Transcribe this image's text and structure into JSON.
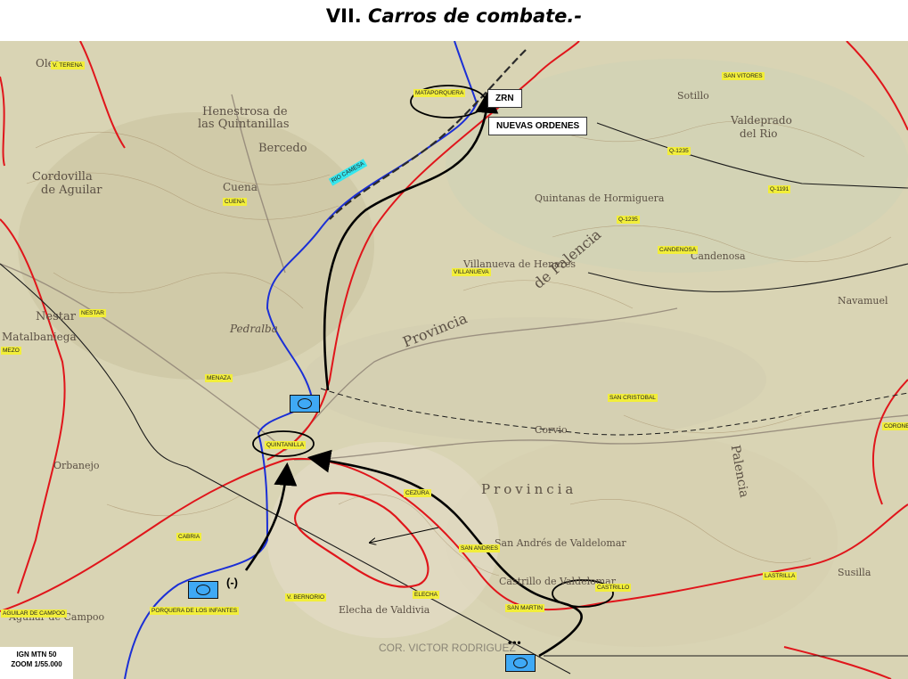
{
  "title": {
    "prefix": "VII.",
    "text": "Carros de combate.-"
  },
  "callouts": {
    "zrn": "ZRN",
    "orders": "NUEVAS ORDENES"
  },
  "scale": {
    "line1": "IGN MTN 50",
    "line2": "ZOOM 1/55.000"
  },
  "unit_minus": "(-)",
  "echelon_dots": "•••",
  "watermark": "COR. VICTOR RODRIGUEZ",
  "labels": {
    "v_terena": "V. TERENA",
    "cuena": "CUENA",
    "nestar": "NESTAR",
    "menaza": "MENAZA",
    "quintanilla": "QUINTANILLA",
    "cabria": "CABRIA",
    "porquera_infantes": "PORQUERA DE LOS INFANTES",
    "v_bernorio": "V. BERNORIO",
    "elecha": "ELECHA",
    "san_martin": "SAN MARTIN",
    "castrillo": "CASTRILLO",
    "lastrilla": "LASTRILLA",
    "san_andres": "SAN ANDRES",
    "cezura": "CEZURA",
    "san_cristobal": "SAN CRISTOBAL",
    "villanueva": "VILLANUEVA",
    "candenosa": "CANDENOSA",
    "mataporquera": "MATAPORQUERA",
    "san_vitores": "SAN VITORES",
    "q1235a": "Q-1235",
    "q1191": "Q-1191",
    "q1235b": "Q-1235",
    "rio_camesa": "RIO CAMESA",
    "coronelo": "CORONELO",
    "aguilar": "AGUILAR DE CAMPOO",
    "mezo": "MEZO"
  },
  "map_text": {
    "henestrosa": "Henestrosa de",
    "quintanillas": "las Quintanillas",
    "bercedo": "Bercedo",
    "cordovilla": "Cordovilla",
    "de_aguilar": "de Aguilar",
    "cuena_town": "Cuena",
    "pedralba": "Pedralba",
    "matalbaniega": "Matalbaniega",
    "nestar_town": "Nestar",
    "provincia": "Provincia",
    "de_palencia": "de Palencia",
    "provincia2": "Provincia",
    "palencia": "Palencia",
    "valdeprado": "Valdeprado",
    "del_rio": "del Rio",
    "san_andres_town": "San Andrés de Valdelomar",
    "castrillo_town": "Castrillo de Valdelomar",
    "elecha_town": "Elecha de Valdivia",
    "villanueva_town": "Villanueva de Henares",
    "aguilar_town": "Aguilar de Campoo",
    "navamuel": "Navamuel",
    "susilla": "Susilla",
    "candenosa_town": "Candenosa",
    "quintanas": "Quintanas de Hormiguera",
    "sotillo": "Sotillo",
    "corvio": "Corvio",
    "orbanejo": "Orbanejo",
    "olea": "Olea"
  },
  "colors": {
    "map_bg": "#d9d4b4",
    "province_border": "#e0151b",
    "river": "#1b2fd6",
    "rail": "#2a2a2a",
    "unit_fill": "#3fa9f5",
    "label_yellow": "#f2ee3a",
    "label_cyan": "#35e6ee"
  },
  "icons": [
    "armored-unit-icon",
    "movement-arrow-icon",
    "objective-ellipse-icon"
  ]
}
